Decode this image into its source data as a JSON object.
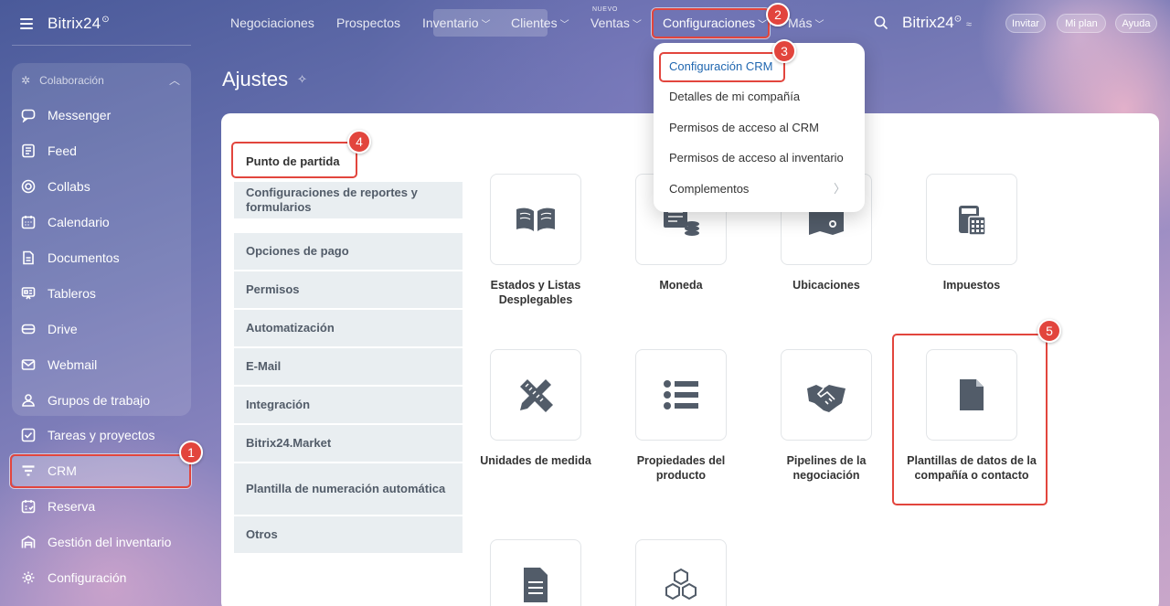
{
  "sidebar": {
    "logo": "Bitrix24",
    "logo_sup": "⊙",
    "group_title": "Colaboración",
    "items": [
      {
        "label": "Messenger",
        "icon": "chat-icon"
      },
      {
        "label": "Feed",
        "icon": "feed-icon"
      },
      {
        "label": "Collabs",
        "icon": "collabs-icon"
      },
      {
        "label": "Calendario",
        "icon": "calendar-icon"
      },
      {
        "label": "Documentos",
        "icon": "document-icon"
      },
      {
        "label": "Tableros",
        "icon": "board-icon"
      },
      {
        "label": "Drive",
        "icon": "drive-icon"
      },
      {
        "label": "Webmail",
        "icon": "mail-icon"
      },
      {
        "label": "Grupos de trabajo",
        "icon": "groups-icon"
      },
      {
        "label": "Tareas y proyectos",
        "icon": "tasks-icon"
      },
      {
        "label": "CRM",
        "icon": "crm-filter-icon"
      },
      {
        "label": "Reserva",
        "icon": "booking-icon"
      },
      {
        "label": "Gestión del inventario",
        "icon": "inventory-icon"
      },
      {
        "label": "Configuración",
        "icon": "gear-icon"
      }
    ]
  },
  "topnav": {
    "items": [
      "Negociaciones",
      "Prospectos",
      "Inventario",
      "Clientes",
      "Ventas",
      "Configuraciones",
      "Más"
    ],
    "nuevo_badge": "NUEVO",
    "brand": "Bitrix24",
    "brand_sup": "⊙",
    "invite": "Invitar",
    "plan": "Mi plan",
    "help": "Ayuda"
  },
  "page": {
    "title": "Ajustes",
    "pin_icon": "✧"
  },
  "tabs": [
    "Punto de partida",
    "Configuraciones de reportes y formularios",
    "Opciones de pago",
    "Permisos",
    "Automatización",
    "E-Mail",
    "Integración",
    "Bitrix24.Market",
    "Plantilla de numeración automática",
    "Otros"
  ],
  "tiles": [
    {
      "label": "Estados y Listas Desplegables",
      "icon": "book-icon"
    },
    {
      "label": "Moneda",
      "icon": "currency-icon"
    },
    {
      "label": "Ubicaciones",
      "icon": "map-icon"
    },
    {
      "label": "Impuestos",
      "icon": "tax-calculator-icon"
    },
    {
      "label": "Unidades de medida",
      "icon": "ruler-pencil-icon"
    },
    {
      "label": "Propiedades del producto",
      "icon": "list-icon"
    },
    {
      "label": "Pipelines de la negociación",
      "icon": "handshake-icon"
    },
    {
      "label": "Plantillas de datos de la compañía o contacto",
      "icon": "file-icon"
    },
    {
      "label": "",
      "icon": "doc-lines-icon"
    },
    {
      "label": "",
      "icon": "cubes-icon"
    }
  ],
  "dropdown": [
    "Configuración CRM",
    "Detalles de mi compañía",
    "Permisos de acceso al CRM",
    "Permisos de acceso al inventario",
    "Complementos"
  ],
  "annotations": [
    "1",
    "2",
    "3",
    "4",
    "5"
  ],
  "colors": {
    "accent_red": "#e2453d",
    "link_blue": "#2067b0",
    "tab_bg": "#e9eef1",
    "icon_gray": "#525c69"
  }
}
